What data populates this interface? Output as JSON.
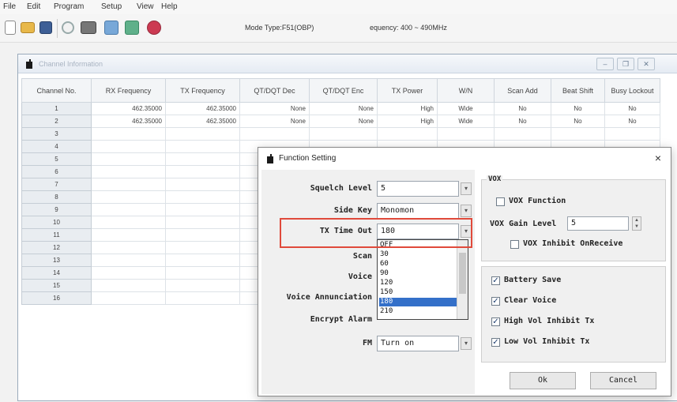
{
  "menu": [
    "File",
    "Edit",
    "Program",
    "Setup",
    "View",
    "Help"
  ],
  "toolbar": {
    "mode_type": "Mode Type:F51(OBP)",
    "frequency": "equency: 400 ~ 490MHz"
  },
  "channel_window": {
    "title": "Channel Information",
    "columns": [
      "Channel No.",
      "RX Frequency",
      "TX Frequency",
      "QT/DQT Dec",
      "QT/DQT Enc",
      "TX Power",
      "W/N",
      "Scan Add",
      "Beat Shift",
      "Busy Lockout"
    ],
    "rows": [
      [
        "1",
        "462.35000",
        "462.35000",
        "None",
        "None",
        "High",
        "Wide",
        "No",
        "No",
        "No"
      ],
      [
        "2",
        "462.35000",
        "462.35000",
        "None",
        "None",
        "High",
        "Wide",
        "No",
        "No",
        "No"
      ],
      [
        "3",
        "",
        "",
        "",
        "",
        "",
        "",
        "",
        "",
        ""
      ],
      [
        "4",
        "",
        "",
        "",
        "",
        "",
        "",
        "",
        "",
        ""
      ],
      [
        "5",
        "",
        "",
        "",
        "",
        "",
        "",
        "",
        "",
        ""
      ],
      [
        "6",
        "",
        "",
        "",
        "",
        "",
        "",
        "",
        "",
        ""
      ],
      [
        "7",
        "",
        "",
        "",
        "",
        "",
        "",
        "",
        "",
        ""
      ],
      [
        "8",
        "",
        "",
        "",
        "",
        "",
        "",
        "",
        "",
        ""
      ],
      [
        "9",
        "",
        "",
        "",
        "",
        "",
        "",
        "",
        "",
        ""
      ],
      [
        "10",
        "",
        "",
        "",
        "",
        "",
        "",
        "",
        "",
        ""
      ],
      [
        "11",
        "",
        "",
        "",
        "",
        "",
        "",
        "",
        "",
        ""
      ],
      [
        "12",
        "",
        "",
        "",
        "",
        "",
        "",
        "",
        "",
        ""
      ],
      [
        "13",
        "",
        "",
        "",
        "",
        "",
        "",
        "",
        "",
        ""
      ],
      [
        "14",
        "",
        "",
        "",
        "",
        "",
        "",
        "",
        "",
        ""
      ],
      [
        "15",
        "",
        "",
        "",
        "",
        "",
        "",
        "",
        "",
        ""
      ],
      [
        "16",
        "",
        "",
        "",
        "",
        "",
        "",
        "",
        "",
        ""
      ]
    ]
  },
  "dialog": {
    "title": "Function Setting",
    "close": "×",
    "squelch_label": "Squelch Level",
    "squelch_value": "5",
    "side_key_label": "Side Key",
    "side_key_value": "Monomon",
    "tx_timeout_label": "TX Time Out",
    "tx_timeout_value": "180",
    "tx_timeout_options": [
      "OFF",
      "30",
      "60",
      "90",
      "120",
      "150",
      "180",
      "210"
    ],
    "tx_timeout_selected": "180",
    "scan_label": "Scan",
    "voice_label": "Voice",
    "voice_ann_label": "Voice Annunciation",
    "encrypt_label": "Encrypt Alarm",
    "fm_label": "FM",
    "fm_value": "Turn on",
    "vox_group": "VOX",
    "vox_function": "VOX Function",
    "vox_gain_label": "VOX Gain Level",
    "vox_gain_value": "5",
    "vox_inhibit": "VOX Inhibit OnReceive",
    "battery_save": "Battery Save",
    "clear_voice": "Clear Voice",
    "high_vol": "High Vol Inhibit Tx",
    "low_vol": "Low Vol Inhibit Tx",
    "ok": "Ok",
    "cancel": "Cancel"
  }
}
